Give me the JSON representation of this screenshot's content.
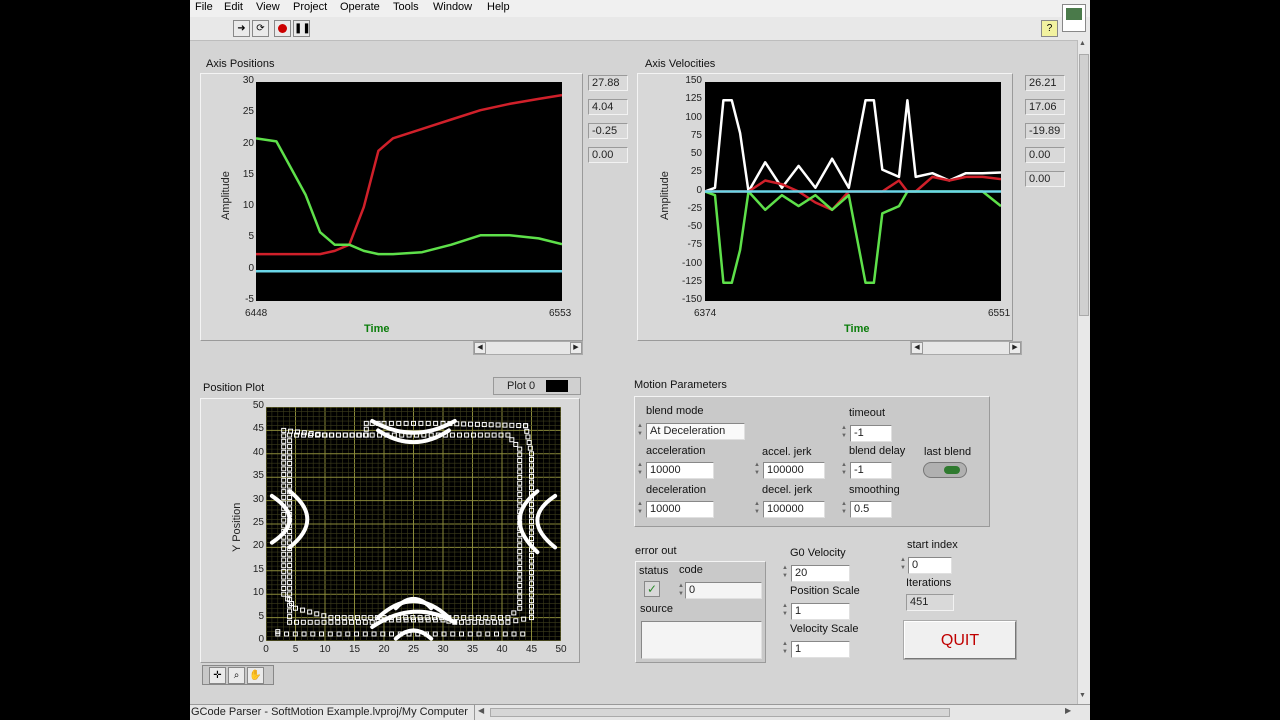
{
  "menu": [
    "File",
    "Edit",
    "View",
    "Project",
    "Operate",
    "Tools",
    "Window",
    "Help"
  ],
  "toolbar": {
    "run_icon": "run-arrow-icon",
    "run_continuous_icon": "run-continuous-icon",
    "abort_icon": "abort-icon",
    "pause_icon": "pause-icon",
    "help_icon": "help-icon",
    "help_label": "?"
  },
  "axis_positions": {
    "title": "Axis Positions",
    "x_label": "Time",
    "y_label": "Amplitude",
    "x_min": "6448",
    "x_max": "6553",
    "y_ticks": [
      "30",
      "25",
      "20",
      "15",
      "10",
      "5",
      "0",
      "-5"
    ],
    "indicators": [
      "27.88",
      "4.04",
      "-0.25",
      "0.00"
    ]
  },
  "axis_velocities": {
    "title": "Axis Velocities",
    "x_label": "Time",
    "y_label": "Amplitude",
    "x_min": "6374",
    "x_max": "6551",
    "y_ticks": [
      "150",
      "125",
      "100",
      "75",
      "50",
      "25",
      "0",
      "-25",
      "-50",
      "-75",
      "-100",
      "-125",
      "-150"
    ],
    "indicators": [
      "26.21",
      "17.06",
      "-19.89",
      "0.00",
      "0.00"
    ]
  },
  "position_plot": {
    "title": "Position Plot",
    "y_label": "Y Position",
    "legend": "Plot 0",
    "y_ticks": [
      "50",
      "45",
      "40",
      "35",
      "30",
      "25",
      "20",
      "15",
      "10",
      "5",
      "0"
    ],
    "x_ticks": [
      "0",
      "5",
      "10",
      "15",
      "20",
      "25",
      "30",
      "35",
      "40",
      "45",
      "50"
    ],
    "tools": [
      "cursor-tool-icon",
      "zoom-tool-icon",
      "pan-tool-icon"
    ]
  },
  "motion": {
    "title": "Motion Parameters",
    "blend_mode_label": "blend mode",
    "blend_mode": "At Deceleration",
    "acceleration_label": "acceleration",
    "acceleration": "10000",
    "deceleration_label": "deceleration",
    "deceleration": "10000",
    "accel_jerk_label": "accel. jerk",
    "accel_jerk": "100000",
    "decel_jerk_label": "decel. jerk",
    "decel_jerk": "100000",
    "timeout_label": "timeout",
    "timeout": "-1",
    "blend_delay_label": "blend delay",
    "blend_delay": "-1",
    "smoothing_label": "smoothing",
    "smoothing": "0.5",
    "last_blend_label": "last blend"
  },
  "error_out": {
    "title": "error out",
    "status_label": "status",
    "code_label": "code",
    "code": "0",
    "source_label": "source",
    "source": "",
    "status_icon": "check-icon"
  },
  "g0_velocity_label": "G0 Velocity",
  "g0_velocity": "20",
  "position_scale_label": "Position Scale",
  "position_scale": "1",
  "velocity_scale_label": "Velocity Scale",
  "velocity_scale": "1",
  "start_index_label": "start index",
  "start_index": "0",
  "iterations_label": "Iterations",
  "iterations": "451",
  "quit_label": "QUIT",
  "status_path": "GCode Parser - SoftMotion Example.lvproj/My Computer",
  "colors": {
    "red": "#d0202a",
    "green": "#5ee04a",
    "cyan": "#6ad6e8",
    "white": "#ffffff",
    "quit_text": "#c00000"
  },
  "chart_data": [
    {
      "type": "line",
      "title": "Axis Positions",
      "xlabel": "Time",
      "ylabel": "Amplitude",
      "xlim": [
        6448,
        6553
      ],
      "ylim": [
        -5,
        30
      ],
      "x": [
        6448,
        6455,
        6465,
        6470,
        6475,
        6480,
        6485,
        6490,
        6495,
        6505,
        6515,
        6525,
        6535,
        6545,
        6553
      ],
      "series": [
        {
          "color": "#d0202a",
          "values": [
            2.5,
            2.5,
            2.5,
            2.5,
            3,
            4,
            10,
            19,
            21,
            22.5,
            24,
            25.5,
            26.5,
            27.3,
            27.9
          ]
        },
        {
          "color": "#5ee04a",
          "values": [
            21,
            20.5,
            12,
            6,
            4,
            4,
            3,
            2.5,
            2.5,
            2.8,
            4,
            5.5,
            5.5,
            5,
            4.1
          ]
        },
        {
          "color": "#6ad6e8",
          "values": [
            -0.25,
            -0.25,
            -0.25,
            -0.25,
            -0.25,
            -0.25,
            -0.25,
            -0.25,
            -0.25,
            -0.25,
            -0.25,
            -0.25,
            -0.25,
            -0.25,
            -0.25
          ]
        }
      ]
    },
    {
      "type": "line",
      "title": "Axis Velocities",
      "xlabel": "Time",
      "ylabel": "Amplitude",
      "xlim": [
        6374,
        6551
      ],
      "ylim": [
        -150,
        150
      ],
      "x": [
        6374,
        6380,
        6385,
        6390,
        6395,
        6400,
        6410,
        6420,
        6430,
        6440,
        6450,
        6460,
        6470,
        6475,
        6480,
        6490,
        6495,
        6500,
        6510,
        6520,
        6530,
        6540,
        6551
      ],
      "series": [
        {
          "color": "#ffffff",
          "values": [
            0,
            5,
            125,
            125,
            80,
            0,
            40,
            5,
            35,
            5,
            45,
            5,
            125,
            125,
            30,
            20,
            125,
            20,
            25,
            15,
            25,
            25,
            26
          ]
        },
        {
          "color": "#d0202a",
          "values": [
            0,
            0,
            0,
            0,
            0,
            0,
            15,
            10,
            0,
            -15,
            -25,
            0,
            0,
            0,
            0,
            15,
            0,
            0,
            20,
            15,
            20,
            20,
            17
          ]
        },
        {
          "color": "#5ee04a",
          "values": [
            0,
            -5,
            -125,
            -125,
            -80,
            0,
            -25,
            -5,
            -20,
            -5,
            -25,
            -5,
            -125,
            -125,
            -30,
            -20,
            0,
            0,
            0,
            0,
            0,
            0,
            -20
          ]
        },
        {
          "color": "#6ad6e8",
          "values": [
            0,
            0,
            0,
            0,
            0,
            0,
            0,
            0,
            0,
            0,
            0,
            0,
            0,
            0,
            0,
            0,
            0,
            0,
            0,
            0,
            0,
            0,
            0
          ]
        }
      ]
    }
  ]
}
